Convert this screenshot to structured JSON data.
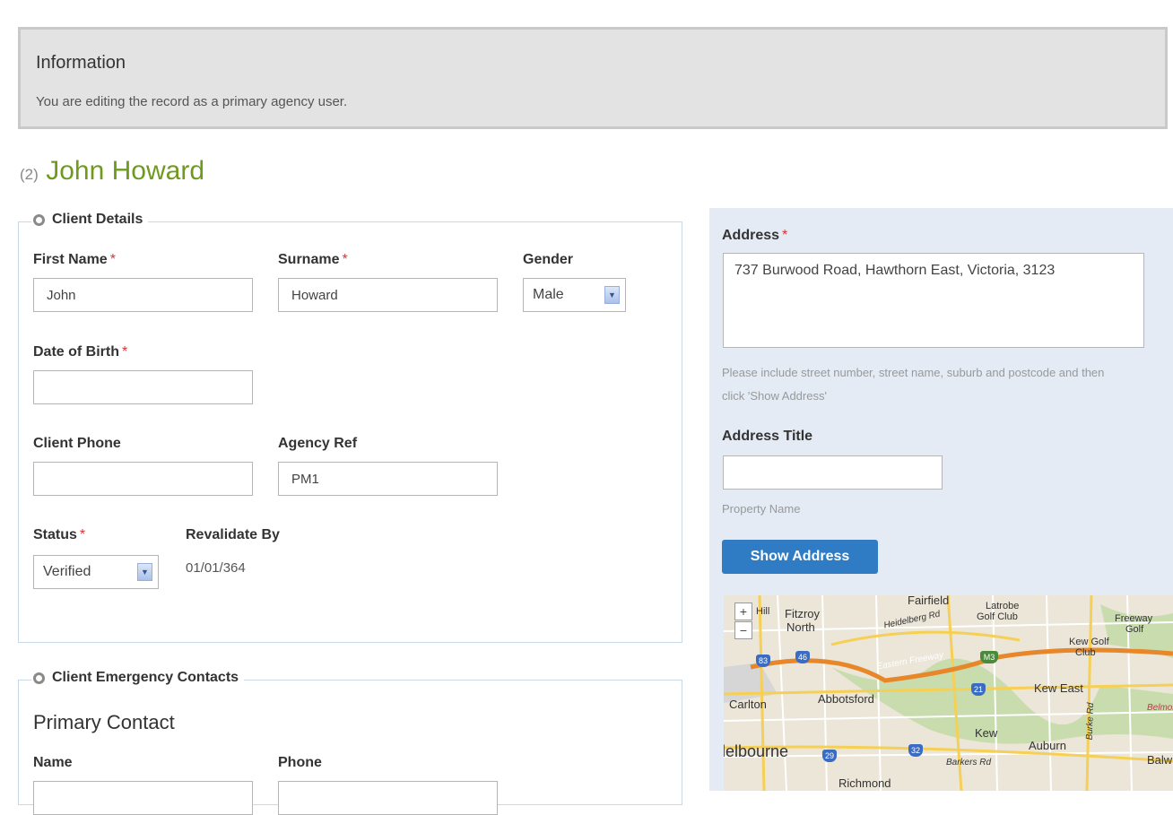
{
  "info": {
    "title": "Information",
    "text": "You are editing the record as a primary agency user."
  },
  "record": {
    "number": "(2)",
    "name": "John Howard"
  },
  "client_details": {
    "legend": "Client Details",
    "first_name_label": "First Name",
    "first_name_value": "John",
    "surname_label": "Surname",
    "surname_value": "Howard",
    "gender_label": "Gender",
    "gender_value": "Male",
    "dob_label": "Date of Birth",
    "dob_value": "",
    "phone_label": "Client Phone",
    "phone_value": "",
    "agency_ref_label": "Agency Ref",
    "agency_ref_value": "PM1",
    "status_label": "Status",
    "status_value": "Verified",
    "revalidate_label": "Revalidate By",
    "revalidate_value": "01/01/364",
    "required_mark": "*"
  },
  "emergency": {
    "legend": "Client Emergency Contacts",
    "primary_heading": "Primary Contact",
    "name_label": "Name",
    "phone_label": "Phone"
  },
  "address": {
    "label": "Address",
    "value": "737 Burwood Road, Hawthorn East, Victoria, 3123",
    "help": "Please include street number, street name, suburb and postcode and then click 'Show Address'",
    "title_label": "Address Title",
    "title_value": "",
    "title_help": "Property Name",
    "show_button": "Show Address"
  },
  "map": {
    "zoom_in": "+",
    "zoom_out": "−",
    "labels": {
      "fairfield": "Fairfield",
      "latrobe": "Latrobe",
      "golf_club": "Golf Club",
      "fitzroy": "Fitzroy",
      "north": "North",
      "hill": "Hill",
      "freeway": "Freeway",
      "golf": "Golf",
      "kew_golf": "Kew Golf",
      "club": "Club",
      "heidelberg_rd": "Heidelberg Rd",
      "eastern_freeway": "Eastern Freeway",
      "carlton": "Carlton",
      "abbotsford": "Abbotsford",
      "kew_east": "Kew East",
      "kew": "Kew",
      "belmore": "Belmore",
      "melbourne": "lelbourne",
      "auburn": "Auburn",
      "barkers_rd": "Barkers Rd",
      "balw": "Balw",
      "richmond": "Richmond",
      "burke_rd": "Burke Rd"
    },
    "shields": {
      "s83": "83",
      "s46": "46",
      "sM3": "M3",
      "s21": "21",
      "s29": "29",
      "s32": "32"
    }
  }
}
